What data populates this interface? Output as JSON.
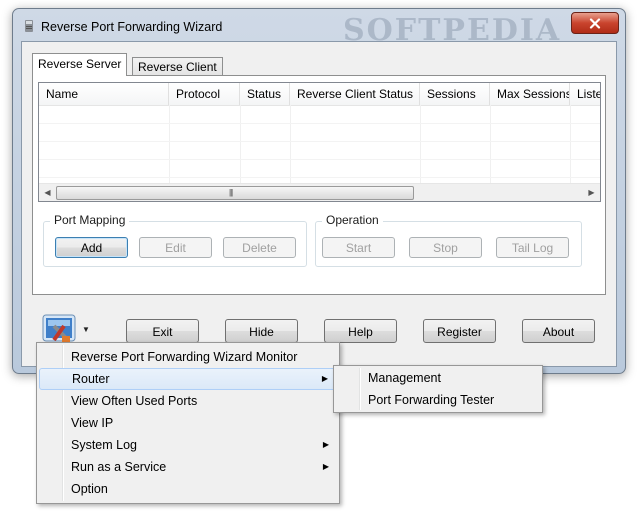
{
  "window": {
    "title": "Reverse Port Forwarding Wizard",
    "watermark": "SOFTPEDIA",
    "close_label": "✕"
  },
  "tabs": [
    {
      "label": "Reverse Server",
      "active": true
    },
    {
      "label": "Reverse Client",
      "active": false
    }
  ],
  "table": {
    "columns": [
      "Name",
      "Protocol",
      "Status",
      "Reverse Client Status",
      "Sessions",
      "Max Sessions",
      "Listen"
    ],
    "rows": []
  },
  "port_mapping": {
    "label": "Port Mapping",
    "add": "Add",
    "edit": "Edit",
    "delete": "Delete"
  },
  "operation": {
    "label": "Operation",
    "start": "Start",
    "stop": "Stop",
    "tail_log": "Tail Log"
  },
  "bottom_buttons": {
    "exit": "Exit",
    "hide": "Hide",
    "help": "Help",
    "register": "Register",
    "about": "About"
  },
  "context_menu": {
    "items": [
      {
        "label": "Reverse Port Forwarding Wizard Monitor",
        "submenu": false
      },
      {
        "label": "Router",
        "submenu": true,
        "highlighted": true
      },
      {
        "label": "View Often Used Ports",
        "submenu": false
      },
      {
        "label": "View IP",
        "submenu": false
      },
      {
        "label": "System Log",
        "submenu": true
      },
      {
        "label": "Run as a Service",
        "submenu": true
      },
      {
        "label": "Option",
        "submenu": false
      }
    ]
  },
  "router_submenu": {
    "items": [
      {
        "label": "Management"
      },
      {
        "label": "Port Forwarding Tester"
      }
    ]
  },
  "colors": {
    "frame": "#b9c9dc",
    "close_button": "#c9442e",
    "menu_highlight": "#dbe9f8"
  }
}
